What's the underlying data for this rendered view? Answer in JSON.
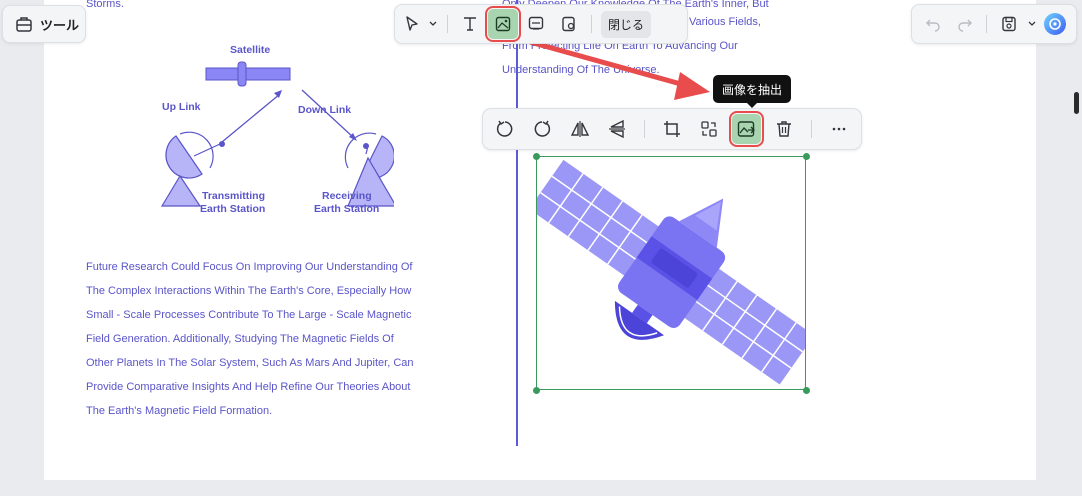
{
  "tools_button": {
    "label": "ツール",
    "icon": "toolbox-icon"
  },
  "main_toolbar": {
    "close_label": "閉じる",
    "items": [
      "select-arrow-icon",
      "chevron-down-icon",
      "text-icon",
      "image-icon",
      "link-icon",
      "shape-icon"
    ]
  },
  "right_toolbar": {
    "items": [
      "undo-icon",
      "redo-icon",
      "save-icon",
      "chevron-down-icon",
      "ai-assistant-icon"
    ]
  },
  "tooltip": {
    "text": "画像を抽出"
  },
  "image_toolbar": {
    "items": [
      "rotate-left-icon",
      "rotate-right-icon",
      "flip-horizontal-icon",
      "flip-vertical-icon",
      "crop-icon",
      "replace-icon",
      "extract-image-icon",
      "delete-icon",
      "more-icon"
    ]
  },
  "left_column": {
    "top_fragment": "Storms.",
    "diagram": {
      "satellite": "Satellite",
      "up_link": "Up Link",
      "down_link": "Down Link",
      "transmitting_line1": "Transmitting",
      "transmitting_line2": "Earth Station",
      "receiving_line1": "Receiving",
      "receiving_line2": "Earth Station"
    },
    "paragraph": [
      "Future Research Could Focus On Improving Our Understanding Of",
      "The Complex Interactions Within The Earth's Core, Especially How",
      "Small - Scale Processes Contribute To The Large - Scale Magnetic",
      "Field Generation. Additionally, Studying The Magnetic Fields Of",
      "Other Planets In The Solar System, Such As Mars And Jupiter, Can",
      "Provide Comparative Insights And Help Refine Our Theories About",
      "The Earth's Magnetic Field Formation."
    ]
  },
  "right_column": {
    "lines": [
      "Only Deepen Our Knowledge Of The Earth's Inner, But",
      "Various Fields,",
      "From Protecting Life On Earth To Advancing Our",
      "Understanding Of The Universe."
    ]
  },
  "colors": {
    "text": "#5a55c8",
    "accent_green": "#3a9a5c",
    "highlight_red": "#e84c4c",
    "satellite_purple": "#8b86f5"
  }
}
